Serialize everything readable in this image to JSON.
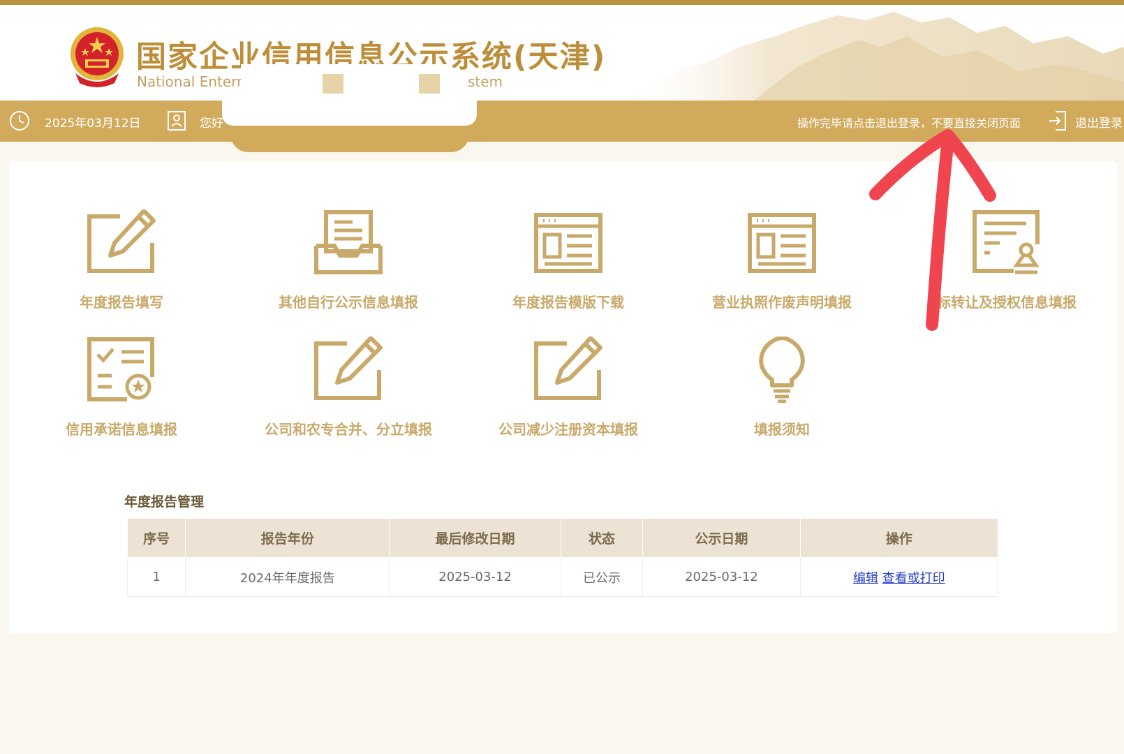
{
  "header": {
    "title": "国家企业信用信息公示系统(天津)",
    "subtitle_left": "National Enterr",
    "subtitle_right": "stem"
  },
  "infobar": {
    "date": "2025年03月12日",
    "greeting": "您好",
    "notice": "操作完毕请点击退出登录，不要直接关闭页面",
    "logout_label": "退出登录"
  },
  "tiles": [
    {
      "label": "年度报告填写",
      "icon": "edit-icon"
    },
    {
      "label": "其他自行公示信息填报",
      "icon": "inbox-document-icon"
    },
    {
      "label": "年度报告模版下载",
      "icon": "template-browser-icon"
    },
    {
      "label": "营业执照作废声明填报",
      "icon": "template-browser-icon"
    },
    {
      "label": "标转让及授权信息填报",
      "icon": "certificate-stamp-icon"
    },
    {
      "label": "信用承诺信息填报",
      "icon": "checklist-badge-icon"
    },
    {
      "label": "公司和农专合并、分立填报",
      "icon": "edit-icon"
    },
    {
      "label": "公司减少注册资本填报",
      "icon": "edit-icon"
    },
    {
      "label": "填报须知",
      "icon": "lightbulb-icon"
    }
  ],
  "report_section": {
    "title": "年度报告管理",
    "columns": [
      "序号",
      "报告年份",
      "最后修改日期",
      "状态",
      "公示日期",
      "操作"
    ],
    "rows": [
      {
        "index": "1",
        "year": "2024年年度报告",
        "modified": "2025-03-12",
        "status": "已公示",
        "published": "2025-03-12",
        "edit_label": "编辑",
        "view_label": "查看或打印"
      }
    ]
  },
  "colors": {
    "accent": "#d2aa5c",
    "icon_gold": "#c9a96a",
    "title_gold": "#bd8d38",
    "link": "#2a40c8",
    "annotation_arrow": "#f0444f"
  }
}
